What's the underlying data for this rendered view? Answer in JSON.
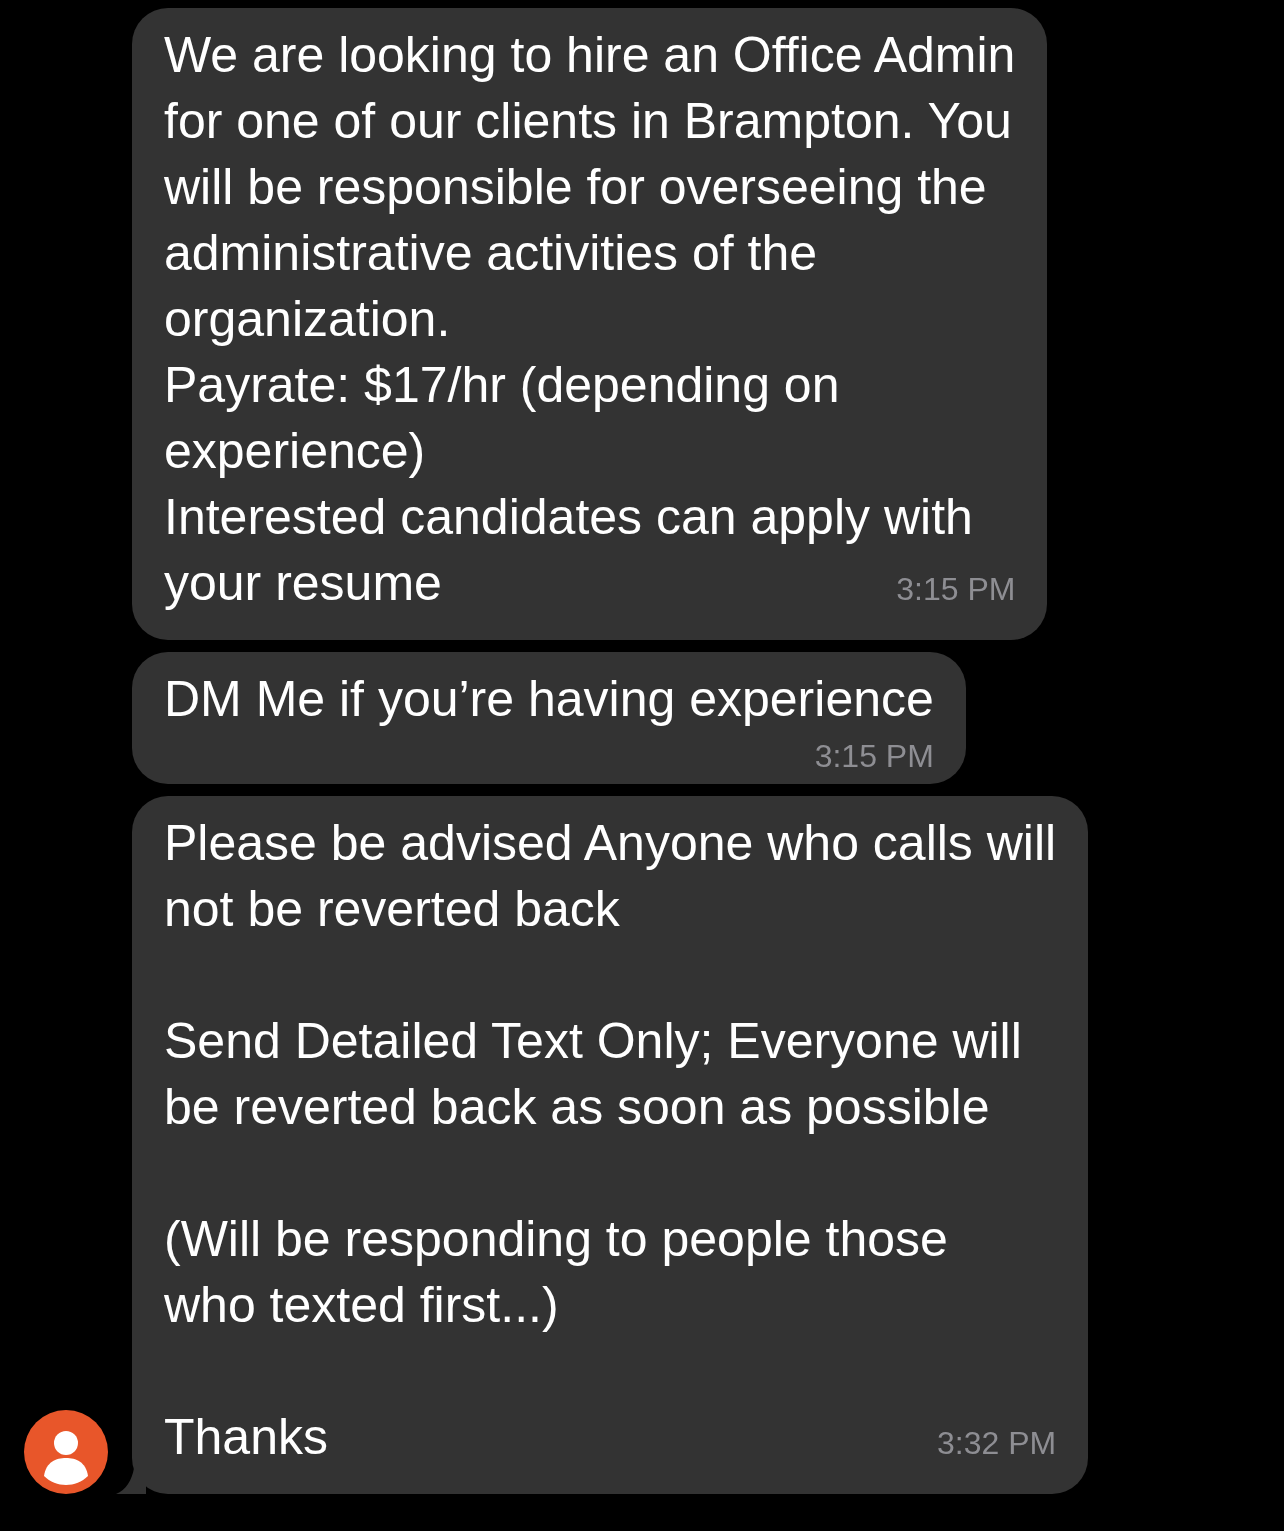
{
  "messages": [
    {
      "paragraphs": [
        [
          "We are looking to hire an Office Admin",
          "for one of our clients in Brampton. You",
          "will be responsible for overseeing the",
          "administrative activities of the",
          "organization."
        ],
        [
          "Payrate: $17/hr (depending on",
          "experience)"
        ],
        [
          "Interested candidates can apply with",
          "your resume"
        ]
      ],
      "time": "3:15 PM",
      "tail": false
    },
    {
      "paragraphs": [
        [
          "DM Me if you’re having experience"
        ]
      ],
      "time": "3:15 PM",
      "tail": false
    },
    {
      "paragraphs": [
        [
          "Please be advised Anyone who calls will",
          "not be reverted back"
        ],
        [
          "Send Detailed Text Only; Everyone will",
          "be reverted back as soon as possible"
        ],
        [
          "(Will be responding to people those",
          "who texted first...)"
        ],
        [
          "Thanks"
        ]
      ],
      "blank_line_between": true,
      "time": "3:32 PM",
      "tail": true
    }
  ]
}
